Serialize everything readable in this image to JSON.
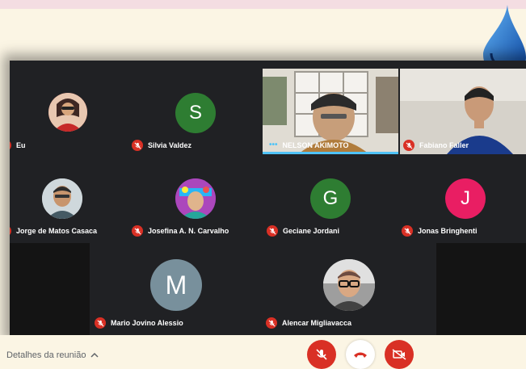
{
  "participants": {
    "eu": "Eu",
    "silvia": {
      "name": "Silvia Valdez",
      "initial": "S"
    },
    "nelson": "NELSON AKIMOTO",
    "fabiano": "Fabiano Faller",
    "jorge": "Jorge de Matos Casaca",
    "josefina": "Josefina A. N. Carvalho",
    "geciane": {
      "name": "Geciane Jordani",
      "initial": "G"
    },
    "jonas": {
      "name": "Jonas Bringhenti",
      "initial": "J"
    },
    "mario": {
      "name": "Mario Jovino Alessio",
      "initial": "M"
    },
    "alencar": "Alencar Migliavacca"
  },
  "footer": {
    "details_label": "Detalhes da reunião"
  },
  "colors": {
    "meet_bg": "#202124",
    "tile_bg": "#3c4043",
    "mic_off": "#d93025",
    "avatar_silvia": "#2e7d32",
    "avatar_geciane": "#2e7d32",
    "avatar_jonas": "#e91e63",
    "avatar_mario": "#78909c",
    "speaking_bar": "#4fc3f7"
  },
  "icons": [
    "mic-off-icon",
    "chevron-up-icon",
    "hang-up-icon",
    "camera-off-icon",
    "water-drop-icon",
    "speaking-dots-icon"
  ]
}
